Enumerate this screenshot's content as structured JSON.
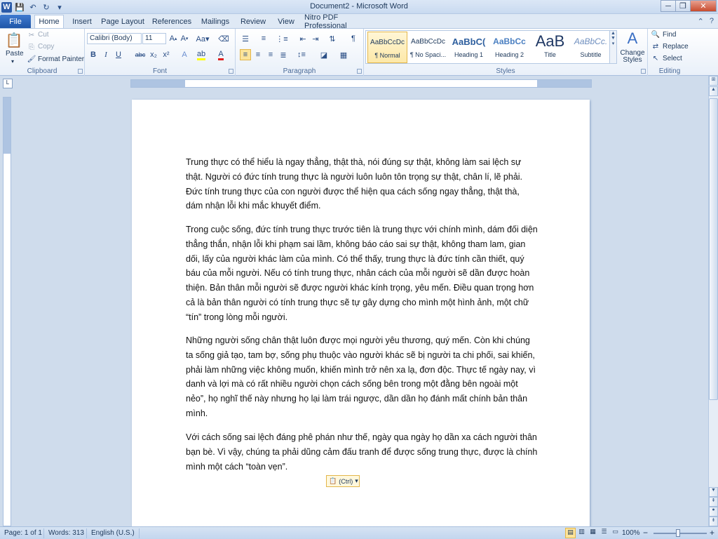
{
  "window": {
    "title": "Document2 - Microsoft Word",
    "controls": {
      "minimize": "─",
      "restore": "❐",
      "close": "✕"
    }
  },
  "qat": {
    "app_icon": "W",
    "save": "💾",
    "undo": "↶",
    "redo": "↻",
    "customize": "▾"
  },
  "tabs": [
    {
      "label": "File"
    },
    {
      "label": "Home"
    },
    {
      "label": "Insert"
    },
    {
      "label": "Page Layout"
    },
    {
      "label": "References"
    },
    {
      "label": "Mailings"
    },
    {
      "label": "Review"
    },
    {
      "label": "View"
    },
    {
      "label": "Nitro PDF Professional"
    }
  ],
  "clipboard": {
    "label": "Clipboard",
    "paste": "Paste",
    "cut": "Cut",
    "copy": "Copy",
    "format_painter": "Format Painter"
  },
  "font": {
    "label": "Font",
    "name": "Calibri (Body)",
    "size": "11"
  },
  "paragraph": {
    "label": "Paragraph"
  },
  "styles": {
    "label": "Styles",
    "items": [
      {
        "sample": "AaBbCcDc",
        "name": "¶ Normal"
      },
      {
        "sample": "AaBbCcDc",
        "name": "¶ No Spaci..."
      },
      {
        "sample": "AaBbC(",
        "name": "Heading 1"
      },
      {
        "sample": "AaBbCc",
        "name": "Heading 2"
      },
      {
        "sample": "AaB",
        "name": "Title"
      },
      {
        "sample": "AaBbCc.",
        "name": "Subtitle"
      }
    ],
    "change_styles": "Change Styles"
  },
  "editing": {
    "label": "Editing",
    "find": "Find",
    "replace": "Replace",
    "select": "Select"
  },
  "document": {
    "paragraphs": [
      "Trung thực có thể hiểu là ngay thẳng, thật thà, nói đúng sự thật, không làm sai lệch sự thật. Người có đức tính trung thực là người luôn luôn tôn trọng sự thật, chân lí, lẽ phải. Đức tính trung thực của con người được thể hiện qua cách sống ngay thẳng, thật thà, dám nhận lỗi khi mắc khuyết điểm.",
      "Trong cuộc sống, đức tính trung thực trước tiên là trung thực với chính mình, dám đối diện thẳng thắn, nhận lỗi khi phạm sai lầm, không báo cáo sai sự thật, không tham lam, gian dối, lấy của người khác làm của mình. Có thể thấy, trung thực là đức tính cần thiết, quý báu của mỗi người. Nếu có tính trung thực, nhân cách của mỗi người sẽ dần được hoàn thiện. Bản thân mỗi người sẽ được người khác kính trọng, yêu mến. Điều quan trọng hơn cả là bản thân người có tính trung thực sẽ tự gây dựng cho mình một hình ảnh, một chữ “tín” trong lòng mỗi người.",
      "Những người sống chân thật luôn được mọi người yêu thương, quý mến. Còn khi chúng ta sống giả tạo, tam bợ, sống phụ thuộc vào người khác sẽ bị người ta chi phối, sai khiến, phải làm những việc không muốn, khiến mình trở nên xa lạ, đơn độc. Thực tế ngày nay, vì danh và lợi mà có rất nhiều người chọn cách sống bên trong một đằng bên ngoài một nẻo”, họ nghĩ thế này nhưng họ lại làm trái ngược, dần dần họ đánh mất chính bản thân mình.",
      "Với cách sống sai lệch đáng phê phán như thế, ngày qua ngày họ dần xa cách người thân bạn bè. Vì vậy, chúng ta phải dũng cảm đấu tranh để được sống trung thực, được là chính mình một cách “toàn vẹn”."
    ],
    "paste_options": "(Ctrl)"
  },
  "status": {
    "page": "Page: 1 of 1",
    "words": "Words: 313",
    "language": "English (U.S.)",
    "zoom": "100%",
    "zoom_out": "−",
    "zoom_in": "+"
  }
}
